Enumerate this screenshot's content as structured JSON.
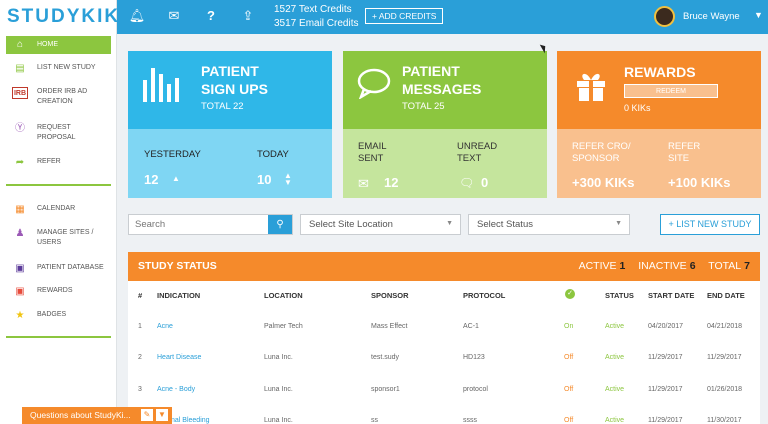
{
  "app": {
    "logo_text": "STUDYKIK"
  },
  "topbar": {
    "icons": [
      "bell-icon",
      "mail-icon",
      "help-icon",
      "upload-icon"
    ],
    "text_credits": "1527 Text Credits",
    "email_credits": "3517 Email Credits",
    "add_credits_label": "+ ADD CREDITS",
    "user_name": "Bruce Wayne"
  },
  "sidebar": {
    "items": [
      {
        "label": "HOME",
        "icon": "home-icon"
      },
      {
        "label": "LIST NEW STUDY",
        "icon": "list-icon"
      },
      {
        "label": "ORDER IRB AD CREATION",
        "icon": "irb-icon"
      },
      {
        "label": "REQUEST PROPOSAL",
        "icon": "proposal-icon"
      },
      {
        "label": "REFER",
        "icon": "refer-icon"
      },
      {
        "label": "CALENDAR",
        "icon": "calendar-icon"
      },
      {
        "label": "MANAGE SITES / USERS",
        "icon": "users-icon"
      },
      {
        "label": "PATIENT DATABASE",
        "icon": "database-icon"
      },
      {
        "label": "REWARDS",
        "icon": "gift-icon"
      },
      {
        "label": "BADGES",
        "icon": "star-icon"
      }
    ]
  },
  "cards": {
    "signups": {
      "title_line1": "PATIENT",
      "title_line2": "SIGN UPS",
      "total": "TOTAL 22",
      "yesterday_label": "YESTERDAY",
      "yesterday_value": "12",
      "today_label": "TODAY",
      "today_value": "10",
      "color": "#2fb7e8",
      "bottom_color": "#7fd6f3"
    },
    "messages": {
      "title_line1": "PATIENT",
      "title_line2": "MESSAGES",
      "total": "TOTAL 25",
      "email_label": "EMAIL SENT",
      "email_value": "12",
      "unread_label": "UNREAD TEXT",
      "unread_value": "0",
      "color": "#8cc63f",
      "bottom_color": "#c5e59d"
    },
    "rewards": {
      "title": "REWARDS",
      "redeem_label": "REDEEM",
      "kiks": "0 KIKs",
      "refer_cro_label": "REFER CRO/ SPONSOR",
      "refer_cro_value": "+300 KIKs",
      "refer_site_label": "REFER SITE",
      "refer_site_value": "+100 KIKs",
      "color": "#f58a2b",
      "bottom_color": "#f9c08e"
    }
  },
  "filters": {
    "search_placeholder": "Search",
    "site_location": "Select Site Location",
    "status": "Select Status",
    "list_new_study": "+ LIST NEW STUDY"
  },
  "study_status": {
    "title": "STUDY STATUS",
    "active_label": "ACTIVE",
    "active_count": "1",
    "inactive_label": "INACTIVE",
    "inactive_count": "6",
    "total_label": "TOTAL",
    "total_count": "7",
    "columns": [
      "#",
      "INDICATION",
      "LOCATION",
      "SPONSOR",
      "PROTOCOL",
      "",
      "STATUS",
      "START DATE",
      "END DATE"
    ],
    "rows": [
      {
        "num": "1",
        "indication": "Acne",
        "location": "Palmer Tech",
        "sponsor": "Mass Effect",
        "protocol": "AC-1",
        "toggle": "On",
        "status": "Active",
        "start": "04/20/2017",
        "end": "04/21/2018"
      },
      {
        "num": "2",
        "indication": "Heart Disease",
        "location": "Luna Inc.",
        "sponsor": "test.sudy",
        "protocol": "HD123",
        "toggle": "Off",
        "status": "Active",
        "start": "11/29/2017",
        "end": "11/29/2017"
      },
      {
        "num": "3",
        "indication": "Acne - Body",
        "location": "Luna Inc.",
        "sponsor": "sponsor1",
        "protocol": "protocol",
        "toggle": "Off",
        "status": "Active",
        "start": "11/29/2017",
        "end": "01/26/2018"
      },
      {
        "num": "4",
        "indication": "Internal Bleeding",
        "location": "Luna Inc.",
        "sponsor": "ss",
        "protocol": "ssss",
        "toggle": "Off",
        "status": "Active",
        "start": "11/29/2017",
        "end": "11/30/2017"
      }
    ]
  },
  "chat": {
    "label": "Questions about StudyKi..."
  }
}
